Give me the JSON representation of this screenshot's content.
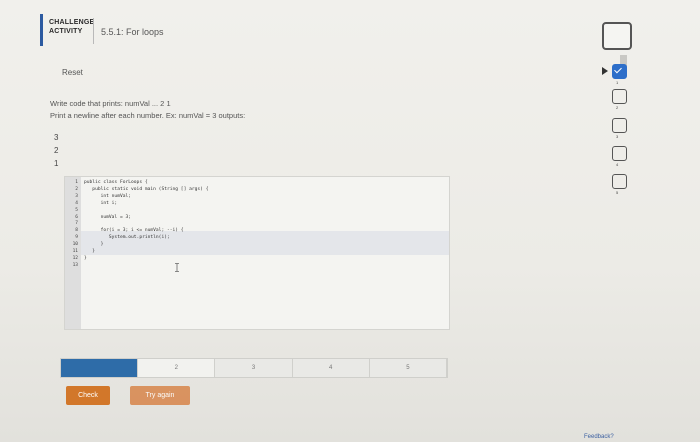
{
  "header": {
    "badge_line1": "CHALLENGE",
    "badge_line2": "ACTIVITY",
    "title": "5.5.1: For loops"
  },
  "reset_label": "Reset",
  "prompt": {
    "line1": "Write code that prints: numVal ... 2 1",
    "line2": "Print a newline after each number. Ex: numVal = 3 outputs:"
  },
  "sample_output": [
    "3",
    "2",
    "1"
  ],
  "code": {
    "line_numbers": [
      "1",
      "2",
      "3",
      "4",
      "5",
      "6",
      "7",
      "8",
      "9",
      "10",
      "11",
      "12",
      "13"
    ],
    "lines": [
      "public class ForLoops {",
      "   public static void main (String [] args) {",
      "      int numVal;",
      "      int i;",
      "",
      "      numVal = 3;",
      "",
      "      for(i = 3; i <= numVal; --i) {",
      "         System.out.println(i);",
      "      }",
      "   }",
      "}",
      ""
    ]
  },
  "progress": {
    "segments": [
      "",
      "2",
      "3",
      "4",
      "5"
    ],
    "completed": 1,
    "current": 2
  },
  "buttons": {
    "check_label": "Check",
    "try_again_label": "Try again"
  },
  "feedback_label": "Feedback?",
  "sidebar_levels": [
    "1",
    "2",
    "3",
    "4",
    "5"
  ],
  "colors": {
    "accent": "#2c5aa0",
    "progress_done": "#2e6ca8",
    "check_button": "#d2772a",
    "level_done": "#2d6ec9"
  }
}
